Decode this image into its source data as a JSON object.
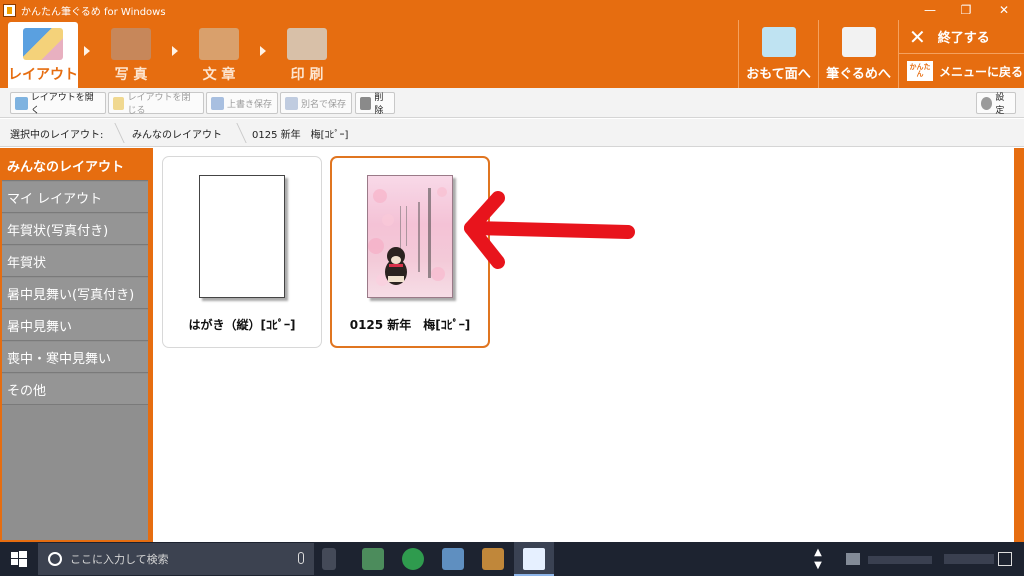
{
  "window": {
    "title": "かんたん筆ぐるめ for Windows",
    "controls": [
      "—",
      "❐",
      "✕"
    ]
  },
  "ribbon": {
    "tabs": [
      {
        "label": "レイアウト",
        "active": true
      },
      {
        "label": "写 真",
        "active": false
      },
      {
        "label": "文 章",
        "active": false
      },
      {
        "label": "印 刷",
        "active": false
      }
    ],
    "omote": "おもて面へ",
    "fudegurume": "筆ぐるめへ",
    "exit": "終了する",
    "menu": "メニューに戻る",
    "kantan_badge": "かんたん"
  },
  "toolbar": {
    "open": "レイアウトを開く",
    "close": "レイアウトを閉じる",
    "overwrite": "上書き保存",
    "save_as": "別名で保存",
    "delete": "削除",
    "settings": "設定"
  },
  "breadcrumb": {
    "label": "選択中のレイアウト:",
    "items": [
      "みんなのレイアウト",
      "0125 新年　梅[ｺﾋﾟｰ]"
    ]
  },
  "sidebar": {
    "items": [
      {
        "label": "みんなのレイアウト",
        "active": true
      },
      {
        "label": "マイ レイアウト"
      },
      {
        "label": "年賀状(写真付き)"
      },
      {
        "label": "年賀状"
      },
      {
        "label": "暑中見舞い(写真付き)"
      },
      {
        "label": "暑中見舞い"
      },
      {
        "label": "喪中・寒中見舞い"
      },
      {
        "label": "その他"
      }
    ]
  },
  "cards": [
    {
      "label": "はがき（縦）[ｺﾋﾟｰ]",
      "selected": false
    },
    {
      "label": "0125 新年　梅[ｺﾋﾟｰ]",
      "selected": true,
      "greeting": "新年あけましておめでとうございます"
    }
  ],
  "taskbar": {
    "search_placeholder": "ここに入力して検索"
  },
  "colors": {
    "accent": "#e66d10",
    "annotation_arrow": "#e8141c"
  }
}
